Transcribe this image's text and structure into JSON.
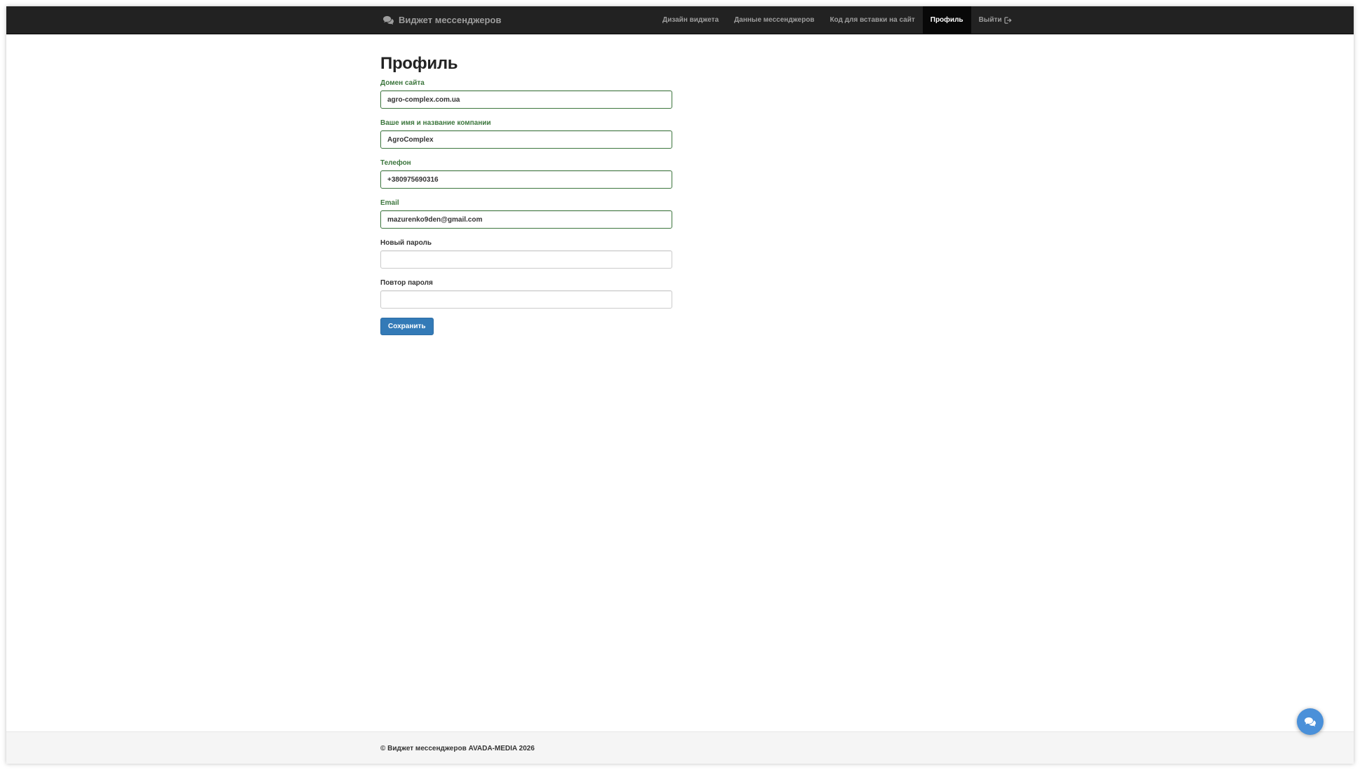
{
  "navbar": {
    "brand_label": "Виджет мессенджеров",
    "brand_icon": "comments-icon",
    "items": [
      {
        "label": "Дизайн виджета",
        "active": false
      },
      {
        "label": "Данные мессенджеров",
        "active": false
      },
      {
        "label": "Код для вставки на сайт",
        "active": false
      },
      {
        "label": "Профиль",
        "active": true
      },
      {
        "label": "Выйти",
        "active": false,
        "icon": "sign-out-icon"
      }
    ]
  },
  "page": {
    "title": "Профиль"
  },
  "form": {
    "domain": {
      "label": "Домен сайта",
      "value": "agro-complex.com.ua"
    },
    "name": {
      "label": "Ваше имя и название компании",
      "value": "AgroComplex"
    },
    "phone": {
      "label": "Телефон",
      "value": "+380975690316"
    },
    "email": {
      "label": "Email",
      "value": "mazurenko9den@gmail.com"
    },
    "new_password": {
      "label": "Новый пароль",
      "value": ""
    },
    "repeat_password": {
      "label": "Повтор пароля",
      "value": ""
    },
    "save_label": "Сохранить"
  },
  "footer": {
    "text": "© Виджет мессенджеров AVADA-MEDIA 2026"
  },
  "chat_widget": {
    "icon": "chat-bubble-icon"
  },
  "colors": {
    "navbar_bg": "#222222",
    "nav_active_bg": "#080808",
    "success_green": "#3c763d",
    "primary_blue": "#337ab7",
    "chat_fab": "#4a90d9"
  }
}
